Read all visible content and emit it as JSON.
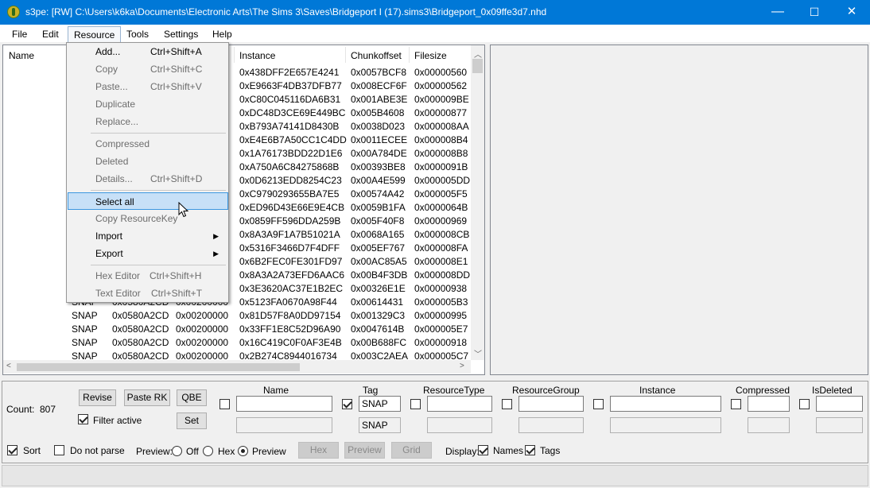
{
  "window": {
    "title": "s3pe: [RW] C:\\Users\\k6ka\\Documents\\Electronic Arts\\The Sims 3\\Saves\\Bridgeport I (17).sims3\\Bridgeport_0x09ffe3d7.nhd",
    "minimize": "—",
    "maximize": "☐",
    "close": "✕"
  },
  "menubar": [
    "File",
    "Edit",
    "Resource",
    "Tools",
    "Settings",
    "Help"
  ],
  "columns": {
    "name": "Name",
    "instance": "Instance",
    "chunkoffset": "Chunkoffset",
    "filesize": "Filesize"
  },
  "rows": [
    [
      "",
      "",
      "",
      "0x438DFF2E657E4241",
      "0x0057BCF8",
      "0x00000560"
    ],
    [
      "",
      "",
      "",
      "0xE9663F4DB37DFB77",
      "0x008ECF6F",
      "0x00000562"
    ],
    [
      "",
      "",
      "",
      "0xC80C045116DA6B31",
      "0x001ABE3E",
      "0x000009BE"
    ],
    [
      "",
      "",
      "",
      "0xDC48D3CE69E449BC",
      "0x005B4608",
      "0x00000877"
    ],
    [
      "",
      "",
      "",
      "0xB793A74141D8430B",
      "0x0038D023",
      "0x000008AA"
    ],
    [
      "",
      "",
      "",
      "0xE4E6B7A50CC1C4DD",
      "0x0011ECEE",
      "0x000008B4"
    ],
    [
      "",
      "",
      "",
      "0x1A76173BDD22D1E6",
      "0x00A784DE",
      "0x000008B8"
    ],
    [
      "",
      "",
      "",
      "0xA750A6C84275868B",
      "0x00393BE8",
      "0x0000091B"
    ],
    [
      "",
      "",
      "",
      "0x0D6213EDD8254C23",
      "0x00A4E599",
      "0x000005DD"
    ],
    [
      "",
      "",
      "",
      "0xC9790293655BA7E5",
      "0x00574A42",
      "0x000005F5"
    ],
    [
      "",
      "",
      "",
      "0xED96D43E66E9E4CB",
      "0x0059B1FA",
      "0x0000064B"
    ],
    [
      "",
      "",
      "",
      "0x0859FF596DDA259B",
      "0x005F40F8",
      "0x00000969"
    ],
    [
      "",
      "",
      "",
      "0x8A3A9F1A7B51021A",
      "0x0068A165",
      "0x000008CB"
    ],
    [
      "",
      "",
      "",
      "0x5316F3466D7F4DFF",
      "0x005EF767",
      "0x000008FA"
    ],
    [
      "",
      "",
      "",
      "0x6B2FEC0FE301FD97",
      "0x00AC85A5",
      "0x000008E1"
    ],
    [
      "",
      "",
      "",
      "0x8A3A2A73EFD6AAC6",
      "0x00B4F3DB",
      "0x000008DD"
    ],
    [
      "",
      "",
      "",
      "0x3E3620AC37E1B2EC",
      "0x00326E1E",
      "0x00000938"
    ],
    [
      "",
      "SNAP",
      "0x0580A2CD",
      "0x5123FA0670A98F44",
      "0x00614431",
      "0x000005B3"
    ],
    [
      "",
      "SNAP",
      "0x0580A2CD",
      "0x81D57F8A0DD97154",
      "0x001329C3",
      "0x00000995"
    ],
    [
      "",
      "SNAP",
      "0x0580A2CD",
      "0x33FF1E8C52D96A90",
      "0x0047614B",
      "0x000005E7"
    ],
    [
      "",
      "SNAP",
      "0x0580A2CD",
      "0x16C419C0F0AF3E4B",
      "0x00B688FC",
      "0x00000918"
    ],
    [
      "",
      "SNAP",
      "0x0580A2CD",
      "0x2B274C8944016734",
      "0x003C2AEA",
      "0x000005C7"
    ]
  ],
  "row_group": "0x00200000",
  "resource_menu": {
    "add": {
      "label": "Add...",
      "shortcut": "Ctrl+Shift+A"
    },
    "copy": {
      "label": "Copy",
      "shortcut": "Ctrl+Shift+C"
    },
    "paste": {
      "label": "Paste...",
      "shortcut": "Ctrl+Shift+V"
    },
    "duplicate": {
      "label": "Duplicate"
    },
    "replace": {
      "label": "Replace..."
    },
    "compressed": {
      "label": "Compressed"
    },
    "deleted": {
      "label": "Deleted"
    },
    "details": {
      "label": "Details...",
      "shortcut": "Ctrl+Shift+D"
    },
    "select_all": {
      "label": "Select all"
    },
    "copy_resourcekey": {
      "label": "Copy ResourceKey"
    },
    "import": {
      "label": "Import"
    },
    "export": {
      "label": "Export"
    },
    "hex_editor": {
      "label": "Hex Editor",
      "shortcut": "Ctrl+Shift+H"
    },
    "text_editor": {
      "label": "Text Editor",
      "shortcut": "Ctrl+Shift+T"
    }
  },
  "bottom": {
    "count_label": "Count:",
    "count_value": "807",
    "revise": "Revise",
    "paste_rk": "Paste RK",
    "qbe": "QBE",
    "set": "Set",
    "filter_active": "Filter active",
    "filter_headers": {
      "name": "Name",
      "tag": "Tag",
      "resource_type": "ResourceType",
      "resource_group": "ResourceGroup",
      "instance": "Instance",
      "compressed": "Compressed",
      "is_deleted": "IsDeleted"
    },
    "tag_value": "SNAP",
    "tag_value_2": "SNAP",
    "sort": "Sort",
    "do_not_parse": "Do not parse",
    "preview_label": "Preview:",
    "preview_off": "Off",
    "preview_hex": "Hex",
    "preview_preview": "Preview",
    "btn_hex": "Hex",
    "btn_preview": "Preview",
    "btn_grid": "Grid",
    "display_label": "Display:",
    "display_names": "Names",
    "display_tags": "Tags"
  }
}
